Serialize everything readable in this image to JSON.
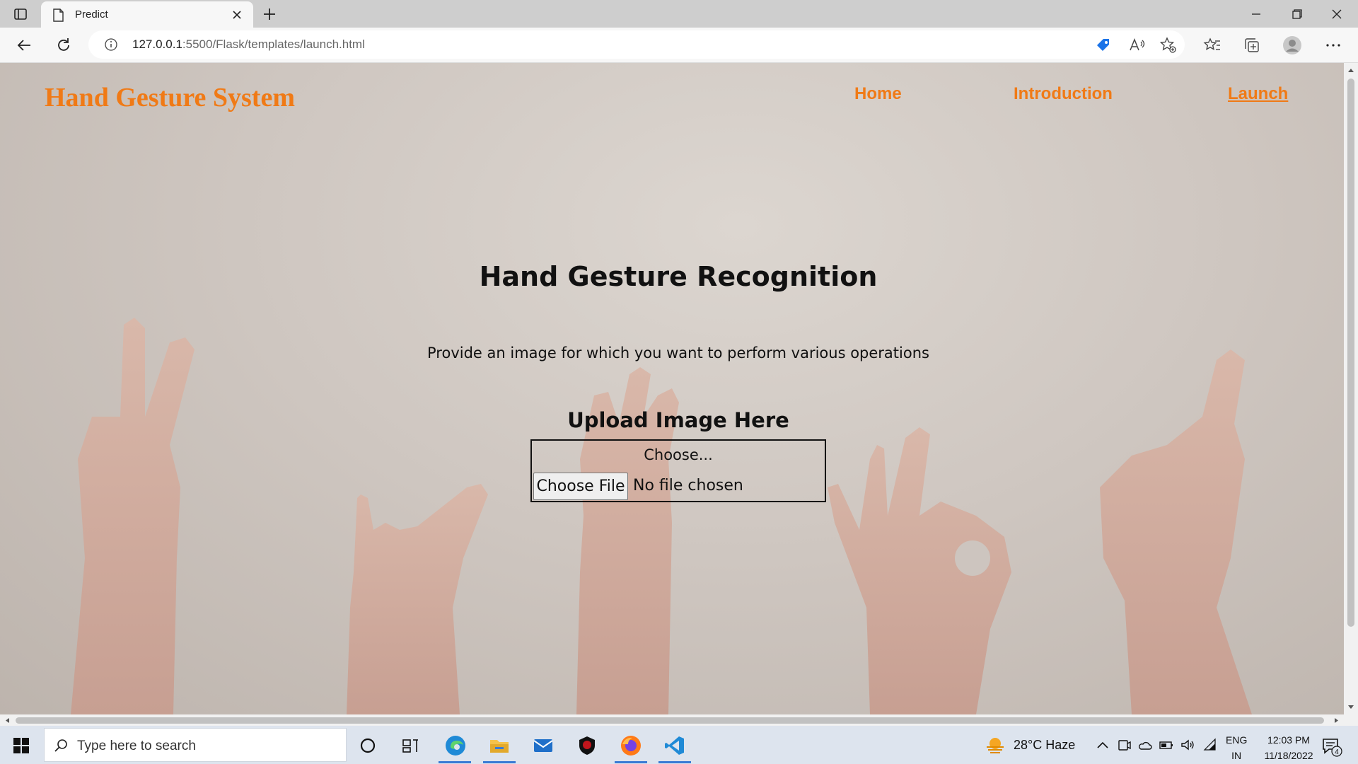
{
  "browser": {
    "tab_title": "Predict",
    "url_host": "127.0.0.1",
    "url_path": ":5500/Flask/templates/launch.html"
  },
  "page": {
    "brand": "Hand Gesture System",
    "nav": [
      "Home",
      "Introduction",
      "Launch"
    ],
    "active_nav": "Launch",
    "heading": "Hand Gesture Recognition",
    "subtext": "Provide an image for which you want to perform various operations",
    "upload_title": "Upload Image Here",
    "choose_label": "Choose...",
    "choose_button": "Choose File",
    "no_file": "No file chosen"
  },
  "colors": {
    "accent": "#f07a16"
  },
  "taskbar": {
    "search_placeholder": "Type here to search",
    "weather": "28°C  Haze",
    "lang_top": "ENG",
    "lang_bottom": "IN",
    "time": "12:03 PM",
    "date": "11/18/2022",
    "notification_count": "4"
  }
}
